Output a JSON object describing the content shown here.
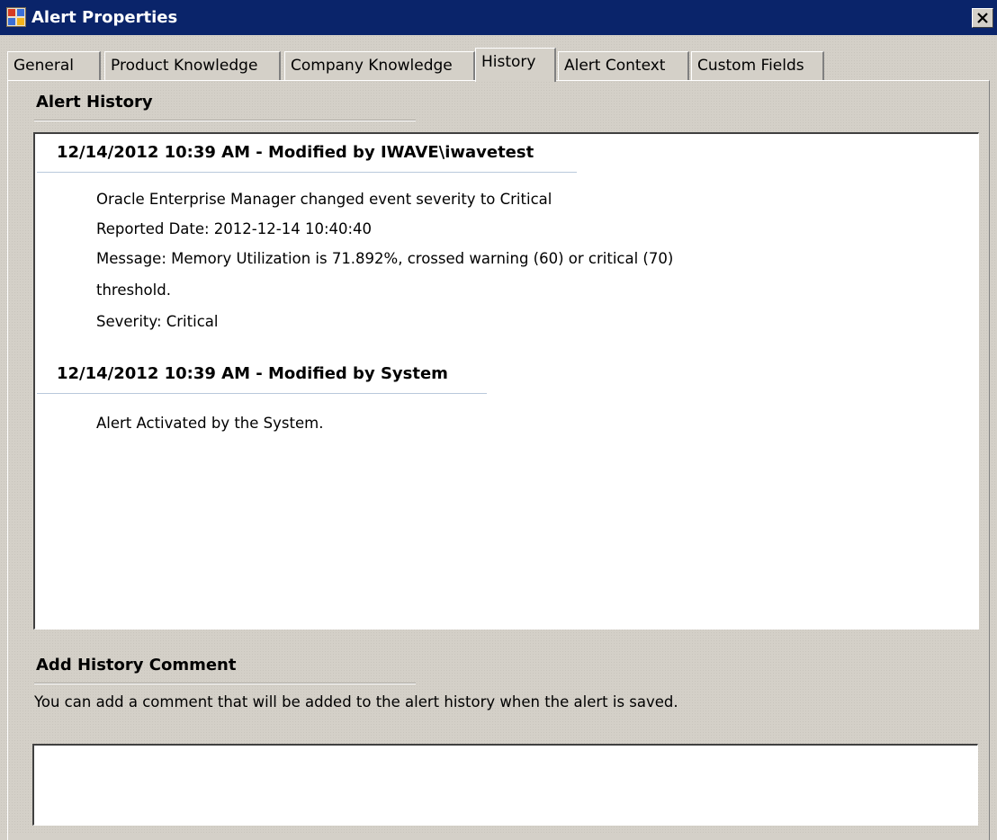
{
  "window": {
    "title": "Alert Properties",
    "icon": "app-window-icon",
    "close": "close-icon"
  },
  "tabs": [
    {
      "label": "General",
      "active": false
    },
    {
      "label": "Product Knowledge",
      "active": false
    },
    {
      "label": "Company Knowledge",
      "active": false
    },
    {
      "label": "History",
      "active": true
    },
    {
      "label": "Alert Context",
      "active": false
    },
    {
      "label": "Custom Fields",
      "active": false
    }
  ],
  "history": {
    "title": "Alert History",
    "entries": [
      {
        "header": "12/14/2012 10:39 AM - Modified by IWAVE\\iwavetest",
        "lines": [
          "Oracle Enterprise Manager changed event severity to Critical",
          "Reported Date: 2012-12-14 10:40:40",
          "Message: Memory Utilization is 71.892%, crossed warning (60) or critical (70)",
          "threshold.",
          "Severity: Critical"
        ]
      },
      {
        "header": "12/14/2012 10:39 AM - Modified by System",
        "lines": [
          "Alert Activated by the System."
        ]
      }
    ]
  },
  "comment": {
    "title": "Add History Comment",
    "hint": "You can add a comment that will be added to the alert history when the alert is saved.",
    "value": "",
    "placeholder": ""
  },
  "colors": {
    "titlebar": "#0a246a",
    "dialog_face": "#d4d0c8",
    "panel_bg": "#ffffff"
  }
}
